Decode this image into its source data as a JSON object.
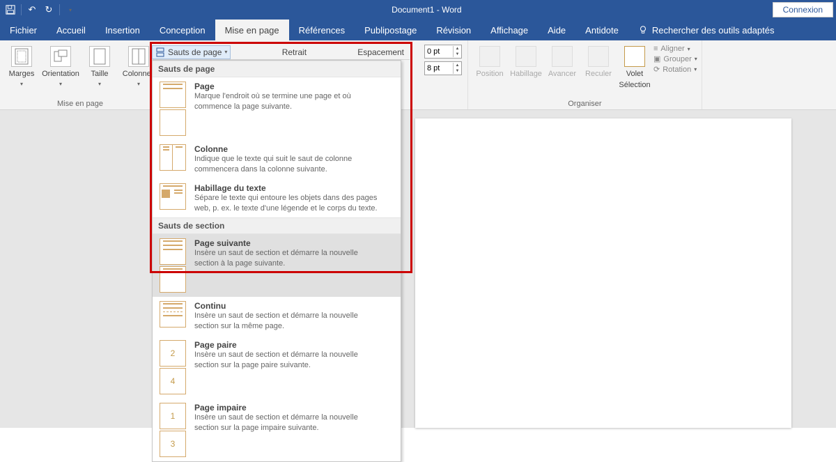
{
  "titlebar": {
    "doc_title": "Document1 - Word",
    "signin": "Connexion"
  },
  "tabs": {
    "items": [
      "Fichier",
      "Accueil",
      "Insertion",
      "Conception",
      "Mise en page",
      "Références",
      "Publipostage",
      "Révision",
      "Affichage",
      "Aide",
      "Antidote"
    ],
    "active_index": 4,
    "tell_me": "Rechercher des outils adaptés"
  },
  "ribbon": {
    "page_setup": {
      "marges": "Marges",
      "orientation": "Orientation",
      "taille": "Taille",
      "colonnes": "Colonnes",
      "group_label": "Mise en page"
    },
    "breaks_button": "Sauts de page",
    "paragraph": {
      "retrait": "Retrait",
      "espacement": "Espacement",
      "before_value": "0 pt",
      "after_value": "8 pt"
    },
    "arrange": {
      "position": "Position",
      "habillage": "Habillage",
      "avancer": "Avancer",
      "reculer": "Reculer",
      "volet": "Volet",
      "selection": "Sélection",
      "aligner": "Aligner",
      "grouper": "Grouper",
      "rotation": "Rotation",
      "group_label": "Organiser"
    }
  },
  "dropdown": {
    "section1_title": "Sauts de page",
    "section2_title": "Sauts de section",
    "items": [
      {
        "title": "Page",
        "desc": "Marque l'endroit où se termine une page et où commence la page suivante."
      },
      {
        "title": "Colonne",
        "desc": "Indique que le texte qui suit le saut de colonne commencera dans la colonne suivante."
      },
      {
        "title": "Habillage du texte",
        "desc": "Sépare le texte qui entoure les objets dans des pages web, p. ex. le texte d'une légende et le corps du texte."
      },
      {
        "title": "Page suivante",
        "desc": "Insère un saut de section et démarre la nouvelle section à la page suivante."
      },
      {
        "title": "Continu",
        "desc": "Insère un saut de section et démarre la nouvelle section sur la même page."
      },
      {
        "title": "Page paire",
        "desc": "Insère un saut de section et démarre la nouvelle section sur la page paire suivante."
      },
      {
        "title": "Page impaire",
        "desc": "Insère un saut de section et démarre la nouvelle section sur la page impaire suivante."
      }
    ]
  }
}
